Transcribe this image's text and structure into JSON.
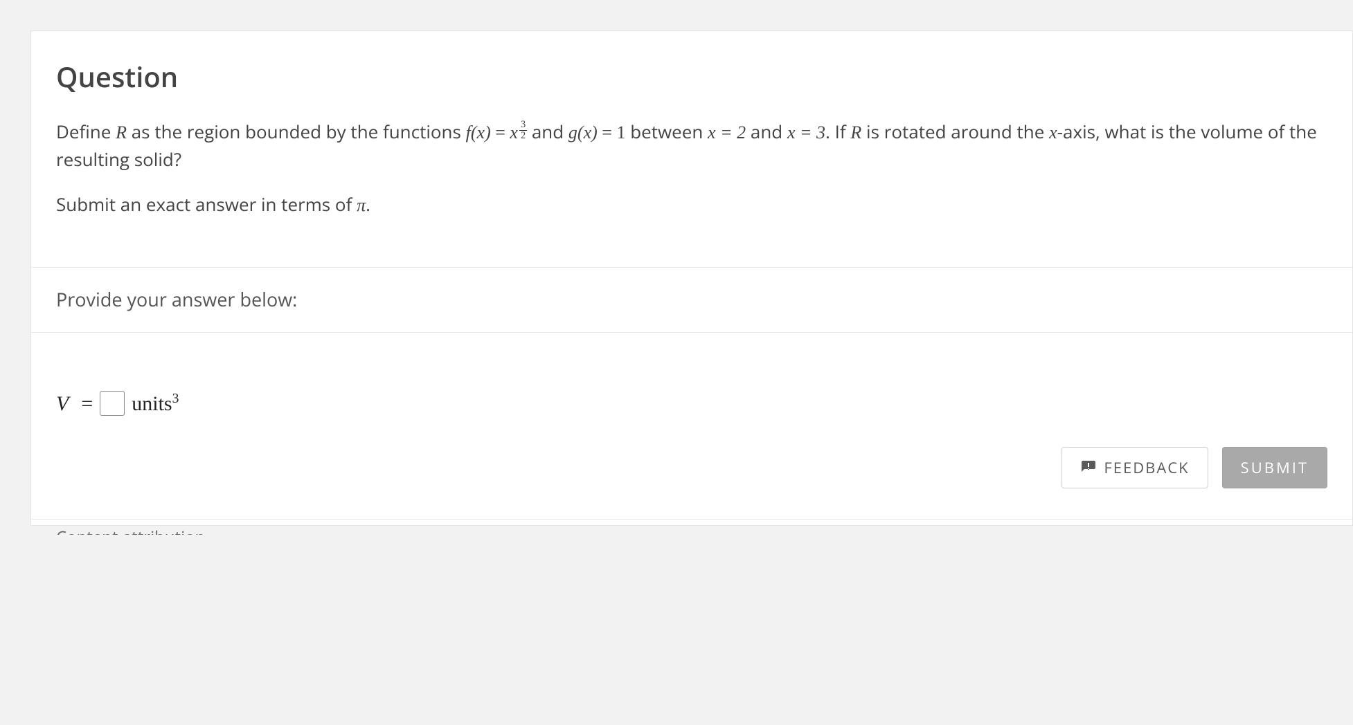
{
  "question": {
    "title": "Question",
    "body_text_pre": "Define ",
    "R": "R",
    "body_text_mid1": " as the region bounded by the functions ",
    "fx": "f(x)",
    "eq": " = ",
    "x": "x",
    "exp_num": "3",
    "exp_den": "2",
    "body_text_mid2": " and ",
    "gx": "g(x)",
    "g_val": "1",
    "body_text_mid3": " between ",
    "x1": "x = 2",
    "body_text_mid4": " and ",
    "x2": "x = 3",
    "body_text_mid5": ". If ",
    "body_text_end": " is rotated around the ",
    "xaxis": "x",
    "body_text_tail": "-axis, what is the volume of the resulting solid?",
    "instruction_pre": "Submit an exact answer in terms of ",
    "pi": "π",
    "instruction_post": "."
  },
  "prompt": {
    "label": "Provide your answer below:"
  },
  "answer": {
    "V": "V",
    "eq": "=",
    "value": "",
    "units": "units",
    "exp": "3"
  },
  "buttons": {
    "feedback": "FEEDBACK",
    "submit": "SUBMIT"
  },
  "attribution": {
    "text": "Content attribution"
  }
}
